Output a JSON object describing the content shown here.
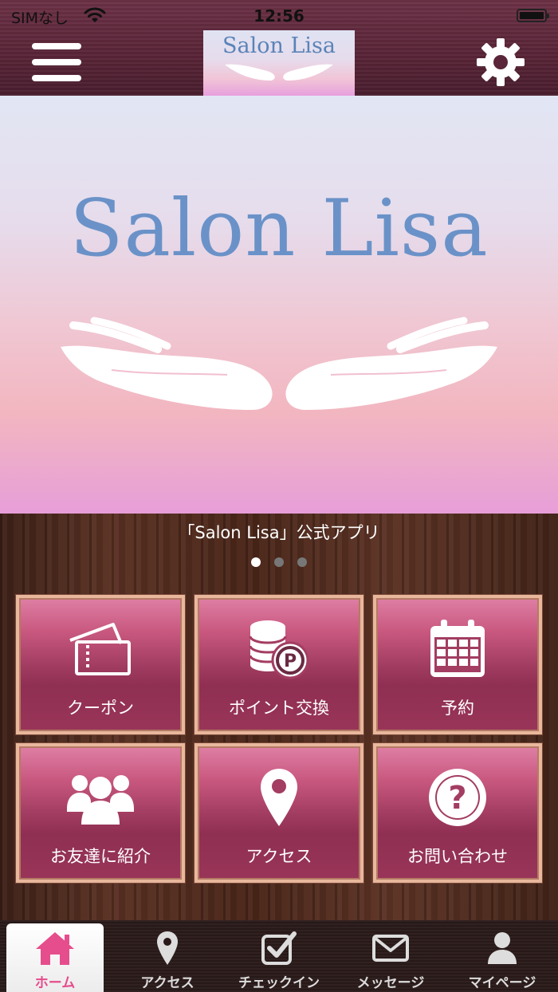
{
  "status_bar": {
    "carrier": "SIMなし",
    "time": "12:56"
  },
  "header": {
    "logo_text": "Salon Lisa"
  },
  "hero": {
    "title": "Salon Lisa"
  },
  "app_caption": "「Salon Lisa」公式アプリ",
  "carousel": {
    "count": 3,
    "active_index": 0
  },
  "tiles": [
    {
      "label": "クーポン",
      "icon": "coupon-ticket-icon"
    },
    {
      "label": "ポイント交換",
      "icon": "point-coins-icon"
    },
    {
      "label": "予約",
      "icon": "calendar-icon"
    },
    {
      "label": "お友達に紹介",
      "icon": "friends-group-icon"
    },
    {
      "label": "アクセス",
      "icon": "map-pin-icon"
    },
    {
      "label": "お問い合わせ",
      "icon": "question-icon"
    }
  ],
  "tabbar": [
    {
      "label": "ホーム",
      "icon": "home-icon",
      "active": true
    },
    {
      "label": "アクセス",
      "icon": "map-pin-icon",
      "active": false
    },
    {
      "label": "チェックイン",
      "icon": "checkin-checkbox-icon",
      "active": false
    },
    {
      "label": "メッセージ",
      "icon": "envelope-icon",
      "active": false
    },
    {
      "label": "マイページ",
      "icon": "user-icon",
      "active": false
    }
  ],
  "colors": {
    "tile_pink": "#c9587f",
    "frame_copper": "#e8b79c",
    "active_tab_pink": "#e64d8c",
    "logo_blue": "#6a92c8"
  }
}
